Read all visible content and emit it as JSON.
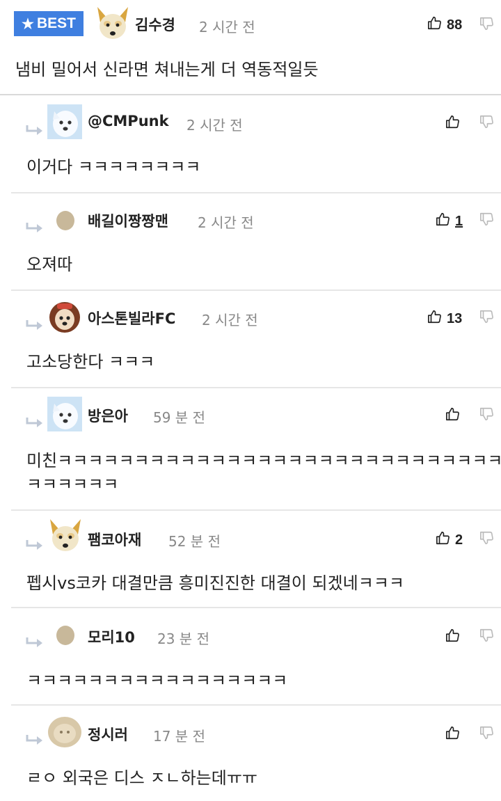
{
  "best_comment": {
    "badge": "BEST",
    "author": "김수경",
    "time": "2 시간 전",
    "likes": "88",
    "body": "냄비 밀어서 신라면 쳐내는게 더 역동적일듯",
    "avatar_icon": "dog-avatar-icon"
  },
  "replies": [
    {
      "author": "@CMPunk",
      "time": "2 시간 전",
      "likes": "",
      "body": "이거다 ㅋㅋㅋㅋㅋㅋㅋㅋ",
      "avatar_icon": "white-dog-avatar-icon"
    },
    {
      "author": "배길이짱짱맨",
      "time": "2 시간 전",
      "likes": "1",
      "body": "오져따",
      "avatar_icon": "default-avatar-icon"
    },
    {
      "author": "아스톤빌라FC",
      "time": "2 시간 전",
      "likes": "13",
      "body": "고소당한다 ㅋㅋㅋ",
      "avatar_icon": "puppy-avatar-icon"
    },
    {
      "author": "방은아",
      "time": "59 분 전",
      "likes": "",
      "body_line1": "미친ㅋㅋㅋㅋㅋㅋㅋㅋㅋㅋㅋㅋㅋㅋㅋㅋㅋㅋㅋㅋㅋㅋㅋㅋㅋㅋㅋㅋㅋ",
      "body_line2": "ㅋㅋㅋㅋㅋㅋ",
      "avatar_icon": "white-dog-avatar-icon"
    },
    {
      "author": "팸코아재",
      "time": "52 분 전",
      "likes": "2",
      "body": "펩시vs코카 대결만큼 흥미진진한 대결이 되겠네ㅋㅋㅋ",
      "avatar_icon": "dog-avatar-icon"
    },
    {
      "author": "모리10",
      "time": "23 분 전",
      "likes": "",
      "body": "ㅋㅋㅋㅋㅋㅋㅋㅋㅋㅋㅋㅋㅋㅋㅋㅋㅋ",
      "avatar_icon": "default-avatar-icon"
    },
    {
      "author": "정시러",
      "time": "17 분 전",
      "likes": "",
      "body": "ㄹㅇ 외국은 디스 ㅈㄴ하는데ㅠㅠ",
      "avatar_icon": "blurry-avatar-icon"
    }
  ],
  "colors": {
    "accent": "#3f7fe0",
    "text": "#222222",
    "muted": "#888888",
    "divider": "#e6e6e6"
  }
}
